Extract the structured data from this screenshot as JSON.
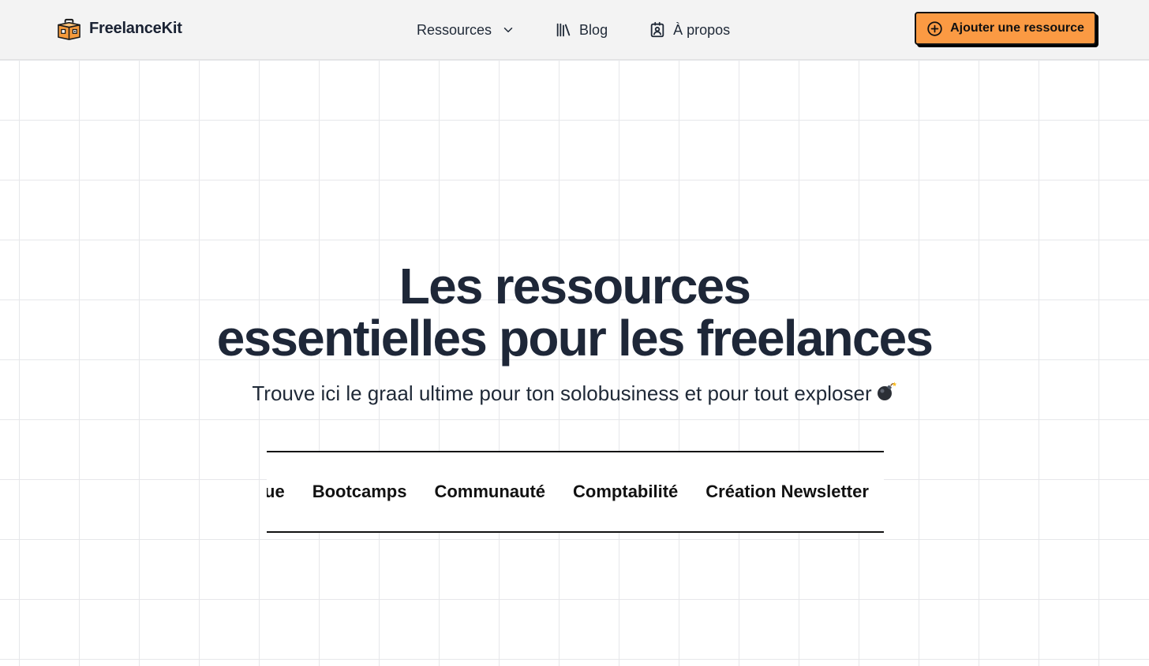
{
  "header": {
    "brand": "FreelanceKit",
    "logo_icon": "toolbox-icon",
    "nav": [
      {
        "label": "Ressources",
        "icon": "chevron-down-icon"
      },
      {
        "label": "Blog",
        "icon": "library-books-icon"
      },
      {
        "label": "À propos",
        "icon": "contact-card-icon"
      }
    ],
    "cta": {
      "label": "Ajouter une ressource",
      "icon": "plus-circle-icon"
    }
  },
  "hero": {
    "title_line1": "Les ressources",
    "title_line2": "essentielles pour les freelances",
    "subtitle": "Trouve ici le graal ultime pour ton solobusiness et pour tout exploser",
    "subtitle_icon": "bomb-icon"
  },
  "categories": [
    "Banque",
    "Bootcamps",
    "Communauté",
    "Comptabilité",
    "Création Newsletter"
  ],
  "colors": {
    "accent": "#fb9a43",
    "text": "#1e2738",
    "header_bg": "#f3f3f3",
    "grid": "#e6e7ea"
  }
}
